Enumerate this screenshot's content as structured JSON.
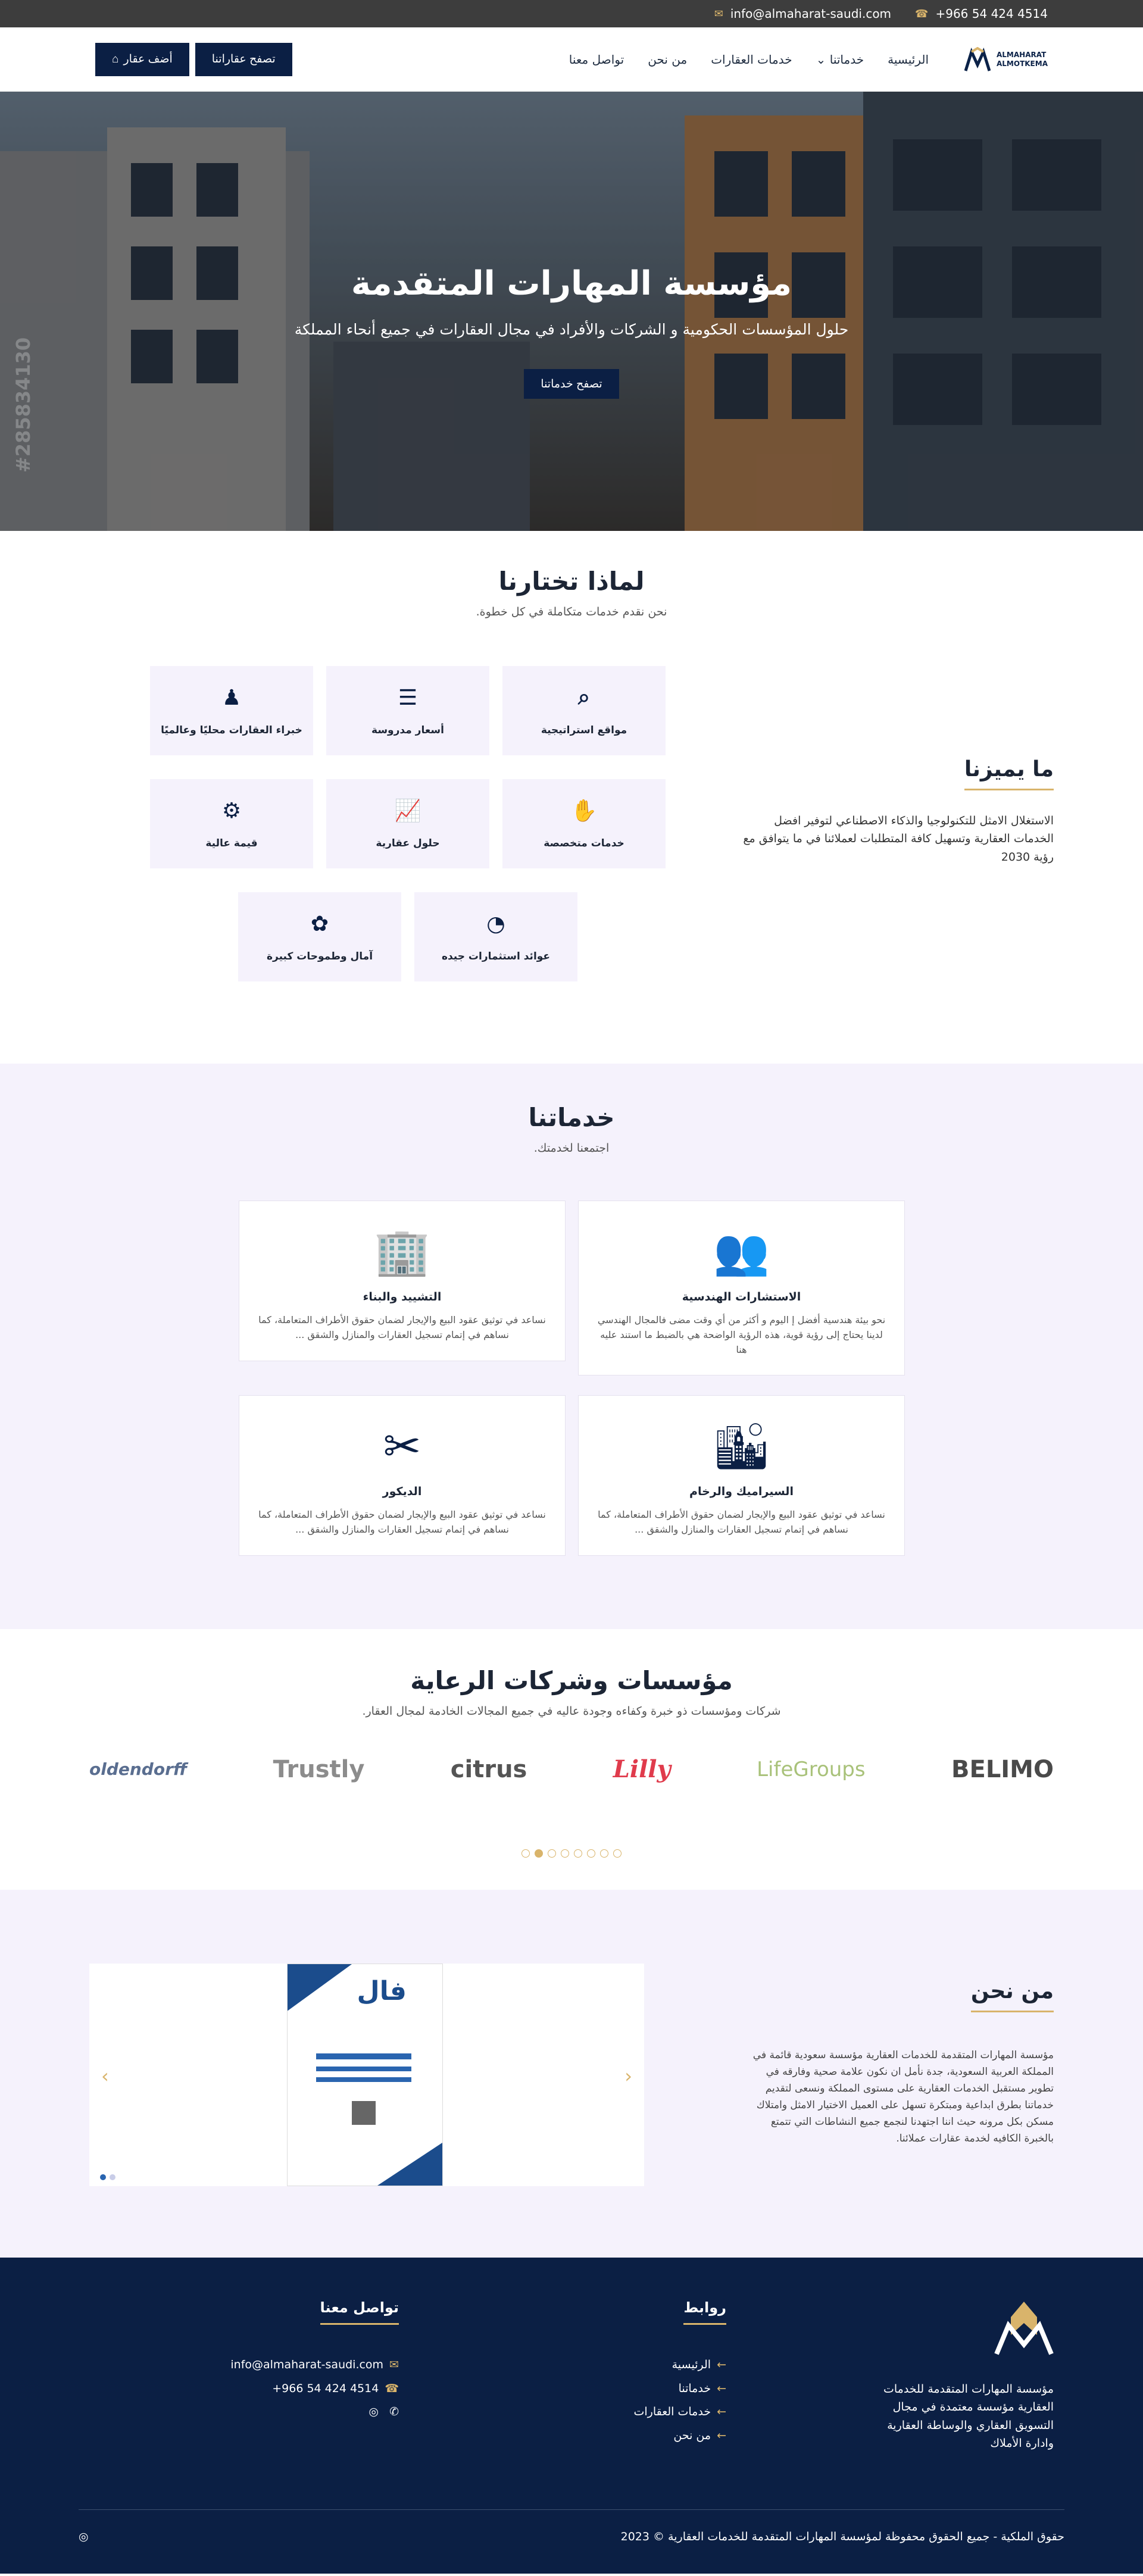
{
  "topbar": {
    "email": "info@almaharat-saudi.com",
    "phone": "+966 54 424 4514"
  },
  "nav": {
    "logo_line1": "ALMAHARAT",
    "logo_line2": "ALMOTKEMA",
    "items": [
      "الرئيسية",
      "خدماتنا",
      "خدمات العقارات",
      "من نحن",
      "تواصل معنا"
    ],
    "browse_button": "تصفح عقاراتنا",
    "add_button": "أضف عقار"
  },
  "hero": {
    "title": "مؤسسة المهارات المتقدمة",
    "subtitle": "حلول المؤسسات الحكومية و الشركات والأفراد في مجال العقارات في جميع أنحاء المملكة",
    "button": "تصفح خدماتنا",
    "watermark": "#285834130"
  },
  "why": {
    "title": "لماذا تختارنا",
    "subtitle": "نحن نقدم خدمات متكاملة في كل خطوة.",
    "features": [
      "مواقع استراتيجية",
      "أسعار مدروسة",
      "خبراء العقارات محليًا وعالميًا",
      "خدمات متخصصة",
      "حلول عقارية",
      "قيمة عالية",
      "عوائد استثمارات جيده",
      "آمال وطموحات كبيرة"
    ],
    "side_title": "ما يميزنا",
    "side_text": "الاستغلال الامثل للتكنولوجيا والذكاء الاصطناعي لتوفير افضل الخدمات العقارية وتسهيل كافة المتطلبات لعملائنا في ما يتوافق مع رؤية 2030"
  },
  "services": {
    "title": "خدماتنا",
    "subtitle": "اجتمعنا لخدمتك.",
    "items": [
      {
        "title": "الاستشارات الهندسية",
        "text": "نحو بيئة هندسية أفضل إ اليوم و أكثر من أي وقت مضى فالمجال الهندسي لدينا يحتاج إلى رؤية قوية، هذه الرؤية الواضحة هي بالضبط ما استند عليه هنا"
      },
      {
        "title": "التشييد والبناء",
        "text": "نساعد في توثيق عقود البيع والإيجار لضمان حقوق الأطراف المتعاملة، كما نساهم في إتمام تسجيل العقارات والمنازل والشقق ..."
      },
      {
        "title": "السيراميك والرخام",
        "text": "نساعد في توثيق عقود البيع والإيجار لضمان حقوق الأطراف المتعاملة، كما نساهم في إتمام تسجيل العقارات والمنازل والشقق ..."
      },
      {
        "title": "الديكور",
        "text": "نساعد في توثيق عقود البيع والإيجار لضمان حقوق الأطراف المتعاملة، كما نساهم في إتمام تسجيل العقارات والمنازل والشقق ..."
      }
    ]
  },
  "partners": {
    "title": "مؤسسات وشركات الرعاية",
    "subtitle": "شركات ومؤسسات ذو خبرة وكفاءه وجودة عاليه في جميع المجالات الخادمة لمجال العقار.",
    "logos": [
      "oldendorff",
      "Trustly",
      "citrus",
      "Lilly",
      "LifeGroups",
      "BELIMO"
    ]
  },
  "about": {
    "title": "من نحن",
    "text": "مؤسسة المهارات المتقدمة للخدمات العقارية مؤسسة سعودية قائمة في المملكة العربية السعودية، جدة نأمل ان نكون علامة صحية وفارقه في تطوير مستقبل الخدمات العقارية على مستوى المملكة ونسعى لتقديم خدماتنا بطرق ابداعية ومبتكرة تسهل على العميل الاختيار الامثل وامتلاك مسكن بكل مرونه حيث اننا اجتهدنا لنجمع جميع النشاطات التي تتمتع بالخبرة الكافيه لخدمة عقارات عملائنا.",
    "doc_brand": "فال"
  },
  "footer": {
    "about_text": "مؤسسة المهارات المتقدمة للخدمات العقارية مؤسسة معتمدة في مجال التسويق العقاري والوساطة العقارية وادارة الأملاك",
    "links_title": "روابط",
    "links": [
      "الرئيسية",
      "خدماتنا",
      "خدمات العقارات",
      "من نحن"
    ],
    "contact_title": "تواصل معنا",
    "email": "info@almaharat-saudi.com",
    "phone": "+966 54 424 4514",
    "copyright": "حقوق الملكية - جميع الحقوق محفوظة لمؤسسة المهارات المتقدمة للخدمات العقارية © 2023"
  }
}
